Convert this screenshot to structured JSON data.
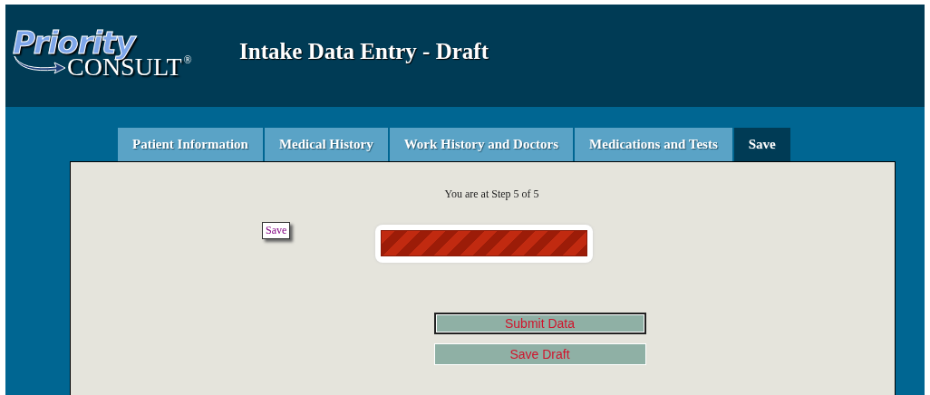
{
  "logo": {
    "top": "Priority",
    "bottom": "CONSULT",
    "mark": "®"
  },
  "header": {
    "title": "Intake Data Entry - Draft"
  },
  "tabs": [
    {
      "label": "Patient Information",
      "selected": false
    },
    {
      "label": "Medical History",
      "selected": false
    },
    {
      "label": "Work History and Doctors",
      "selected": false
    },
    {
      "label": "Medications and Tests",
      "selected": false
    },
    {
      "label": "Save",
      "selected": true
    }
  ],
  "step_text": "You are at Step 5 of 5",
  "save_tag": "Save",
  "progress": {
    "level": 1
  },
  "buttons": [
    {
      "label": "Submit Data",
      "focused": true
    },
    {
      "label": "Save Draft",
      "focused": false
    }
  ]
}
